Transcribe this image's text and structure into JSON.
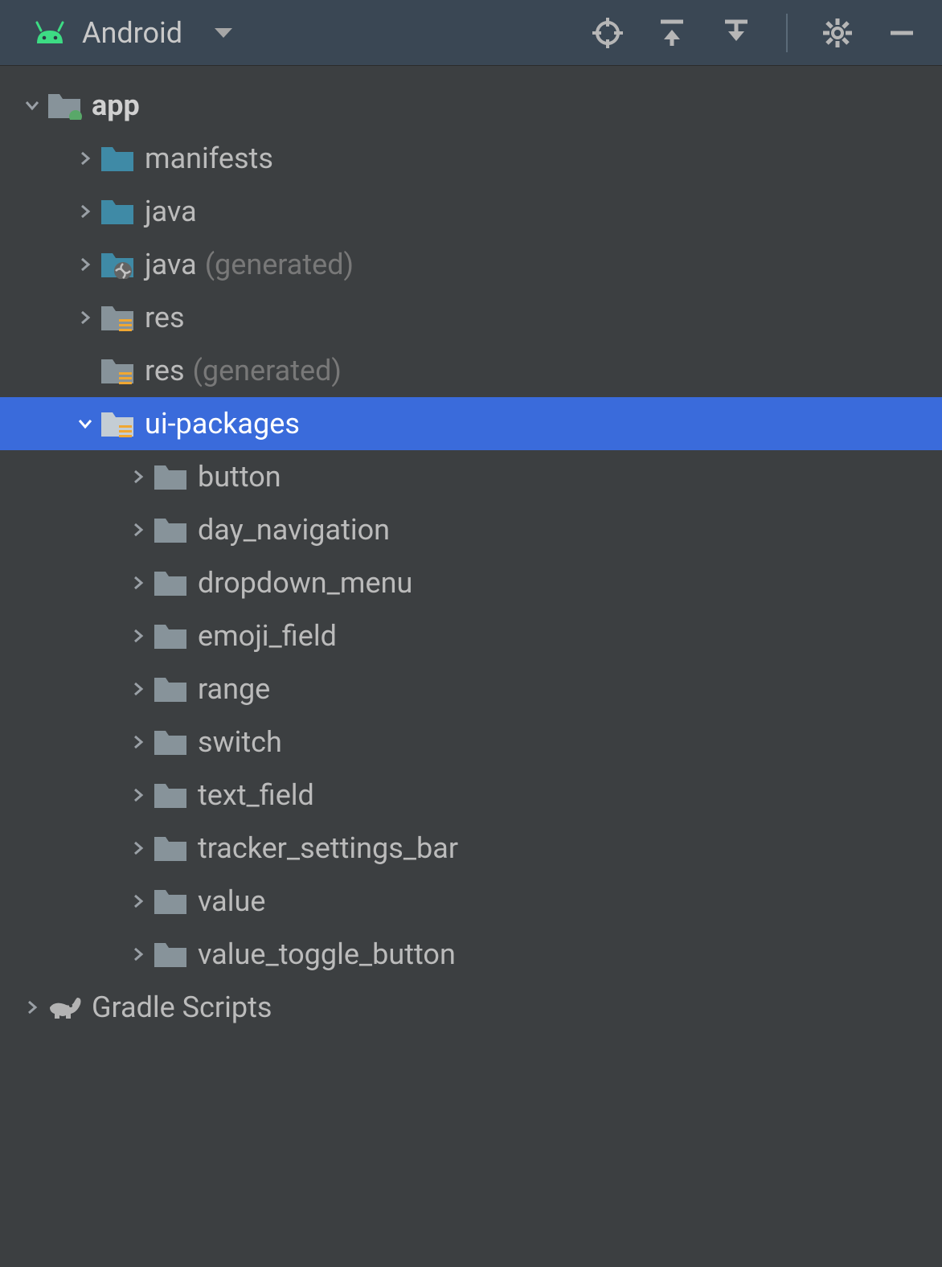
{
  "toolbar": {
    "viewName": "Android"
  },
  "tree": {
    "root": {
      "label": "app",
      "children": [
        {
          "label": "manifests",
          "suffix": ""
        },
        {
          "label": "java",
          "suffix": ""
        },
        {
          "label": "java",
          "suffix": "(generated)"
        },
        {
          "label": "res",
          "suffix": ""
        },
        {
          "label": "res",
          "suffix": "(generated)"
        },
        {
          "label": "ui-packages",
          "children": [
            {
              "label": "button"
            },
            {
              "label": "day_navigation"
            },
            {
              "label": "dropdown_menu"
            },
            {
              "label": "emoji_field"
            },
            {
              "label": "range"
            },
            {
              "label": "switch"
            },
            {
              "label": "text_field"
            },
            {
              "label": "tracker_settings_bar"
            },
            {
              "label": "value"
            },
            {
              "label": "value_toggle_button"
            }
          ]
        }
      ]
    },
    "gradle": {
      "label": "Gradle Scripts"
    }
  }
}
